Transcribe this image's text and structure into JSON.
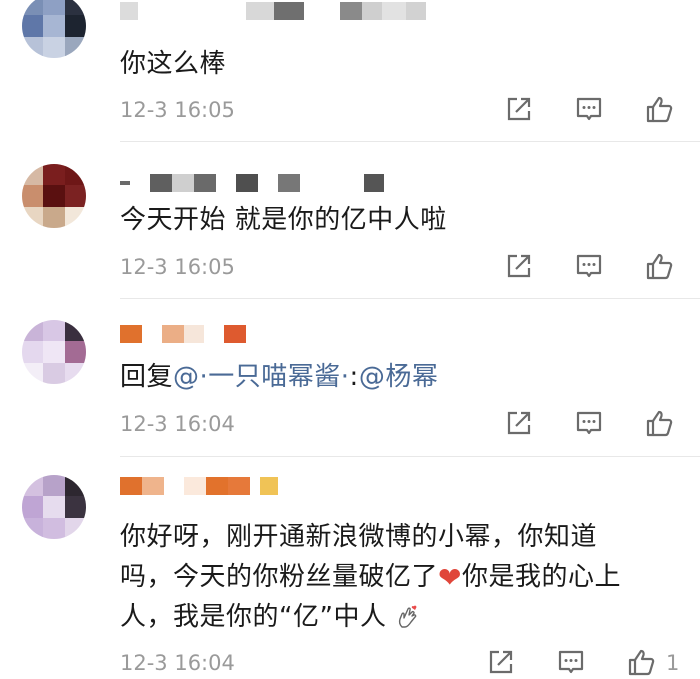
{
  "comments": [
    {
      "text": "你这么棒",
      "time": "12-3 16:05"
    },
    {
      "text": "今天开始 就是你的亿中人啦",
      "time": "12-3 16:05"
    },
    {
      "reply_prefix": "回复",
      "mention_1": "@·一只喵幂酱·",
      "separator": ":",
      "mention_2": "@杨幂",
      "time": "12-3 16:04"
    },
    {
      "line_1": "你好呀，刚开通新浪微博的小幂，你知道",
      "line_2_a": "吗，今天的你粉丝量破亿了",
      "line_2_b": "你是我的心上",
      "line_3": "人，我是你的“亿”中人",
      "time": "12-3 16:04",
      "like_count": "1"
    }
  ],
  "icons": {
    "heart": "❤",
    "heart_color": "#e0463a",
    "mention_color": "#4a6a96",
    "meta_color": "#9a9a9a"
  }
}
